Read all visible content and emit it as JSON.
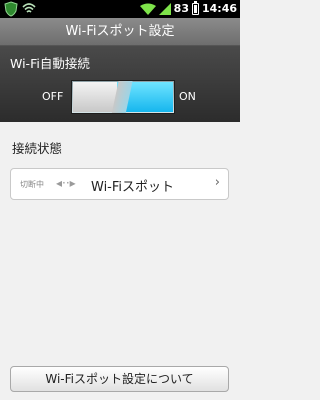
{
  "status_bar": {
    "battery_percent": "83",
    "time": "14:46"
  },
  "title_bar": {
    "title": "Wi-Fiスポット設定"
  },
  "auto_connect": {
    "label": "Wi-Fi自動接続",
    "off_label": "OFF",
    "on_label": "ON",
    "state": "on"
  },
  "connection": {
    "section_label": "接続状態",
    "status": "切断中",
    "name": "Wi-Fiスポット"
  },
  "about_button": {
    "label": "Wi-Fiスポット設定について"
  }
}
